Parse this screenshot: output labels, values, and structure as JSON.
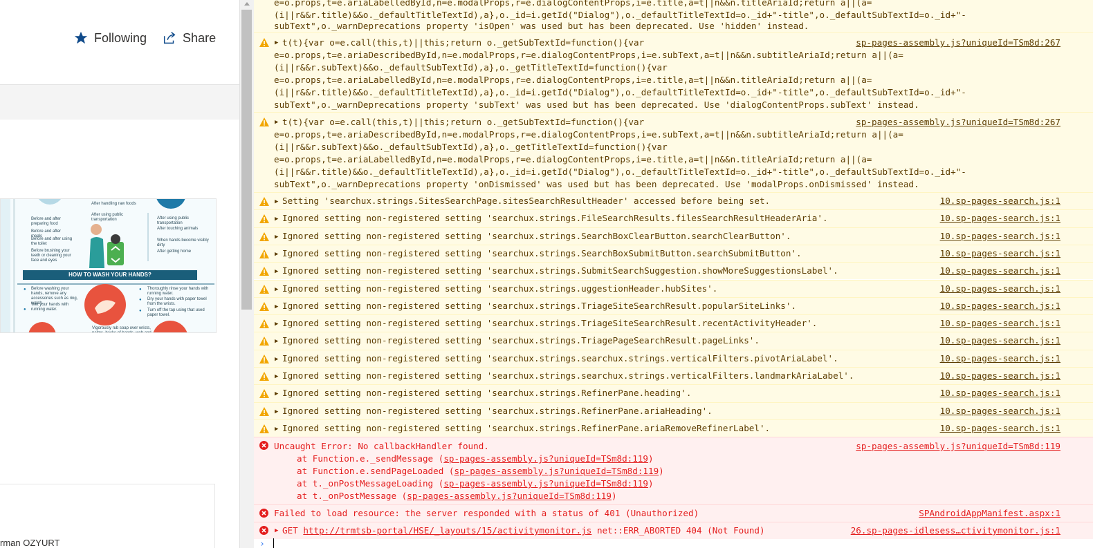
{
  "page": {
    "following_label": "Following",
    "share_label": "Share",
    "author_partial": "rman OZYURT"
  },
  "poster": {
    "col1": [
      "Before and after preparing food",
      "Before and after meals",
      "Before and after using the toilet",
      "Before brushing your teeth or cleaning your face and eyes"
    ],
    "col2_top": "After handling raw foods",
    "col2_b": "After using public transportation",
    "col3": [
      "After using public transportation",
      "After touching animals",
      "When hands become visibly dirty",
      "After getting home"
    ],
    "header": "HOW TO WASH YOUR HANDS?",
    "steps_left": [
      "Before washing your hands, remove any accessories such as ring, watch.",
      "Wet your hands with running water."
    ],
    "steps_right": [
      "Thoroughly rinse your hands with running water.",
      "Dry your hands with paper towel from the wrists.",
      "Turn off the tap using that used paper towel."
    ],
    "step_bottom": "Vigorously rub soap over wrists, palms, backs of hands, web and"
  },
  "console": {
    "warn_top_lines": [
      "e=o.props,t=e.ariaLabelledById,n=e.modalProps,r=e.dialogContentProps,i=e.title,a=t||n&&n.titleAriaId;return a||(a=",
      "(i||r&&r.title)&&o._defaultTitleTextId),a},o._id=i.getId(\"Dialog\"),o._defaultTitleTextId=o._id+\"-title\",o._defaultSubTextId=o._id+\"-",
      "subText\",o._warnDeprecations property 'isOpen' was used but has been deprecated. Use 'hidden' instead."
    ],
    "warn_block2_lines": [
      "t(t){var o=e.call(this,t)||this;return o._getSubTextId=function(){var",
      "e=o.props,t=e.ariaDescribedById,n=e.modalProps,r=e.dialogContentProps,i=e.subText,a=t||n&&n.subtitleAriaId;return a||(a=",
      "(i||r&&r.subText)&&o._defaultSubTextId),a},o._getTitleTextId=function(){var",
      "e=o.props,t=e.ariaLabelledById,n=e.modalProps,r=e.dialogContentProps,i=e.title,a=t||n&&n.titleAriaId;return a||(a=",
      "(i||r&&r.title)&&o._defaultTitleTextId),a},o._id=i.getId(\"Dialog\"),o._defaultTitleTextId=o._id+\"-title\",o._defaultSubTextId=o._id+\"-",
      "subText\",o._warnDeprecations property 'subText' was used but has been deprecated. Use 'dialogContentProps.subText' instead."
    ],
    "warn_block2_src": "sp-pages-assembly.js?uniqueId=TSm8d:267",
    "warn_block3_lines": [
      "t(t){var o=e.call(this,t)||this;return o._getSubTextId=function(){var",
      "e=o.props,t=e.ariaDescribedById,n=e.modalProps,r=e.dialogContentProps,i=e.subText,a=t||n&&n.subtitleAriaId;return a||(a=",
      "(i||r&&r.subText)&&o._defaultSubTextId),a},o._getTitleTextId=function(){var",
      "e=o.props,t=e.ariaLabelledById,n=e.modalProps,r=e.dialogContentProps,i=e.title,a=t||n&&n.titleAriaId;return a||(a=",
      "(i||r&&r.title)&&o._defaultTitleTextId),a},o._id=i.getId(\"Dialog\"),o._defaultTitleTextId=o._id+\"-title\",o._defaultSubTextId=o._id+\"-",
      "subText\",o._warnDeprecations property 'onDismissed' was used but has been deprecated. Use 'modalProps.onDismissed' instead."
    ],
    "warn_block3_src": "sp-pages-assembly.js?uniqueId=TSm8d:267",
    "search_warnings": [
      {
        "msg": "Setting 'searchux.strings.SitesSearchPage.sitesSearchResultHeader' accessed before being set.",
        "src": "10.sp-pages-search.js:1"
      },
      {
        "msg": "Ignored setting non-registered setting 'searchux.strings.FileSearchResults.filesSearchResultHeaderAria'.",
        "src": "10.sp-pages-search.js:1"
      },
      {
        "msg": "Ignored setting non-registered setting 'searchux.strings.SearchBoxClearButton.searchClearButton'.",
        "src": "10.sp-pages-search.js:1"
      },
      {
        "msg": "Ignored setting non-registered setting 'searchux.strings.SearchBoxSubmitButton.searchSubmitButton'.",
        "src": "10.sp-pages-search.js:1"
      },
      {
        "msg": "Ignored setting non-registered setting 'searchux.strings.SubmitSearchSuggestion.showMoreSuggestionsLabel'.",
        "src": "10.sp-pages-search.js:1"
      },
      {
        "msg": "Ignored setting non-registered setting 'searchux.strings.uggestionHeader.hubSites'.",
        "src": "10.sp-pages-search.js:1"
      },
      {
        "msg": "Ignored setting non-registered setting 'searchux.strings.TriageSiteSearchResult.popularSiteLinks'.",
        "src": "10.sp-pages-search.js:1"
      },
      {
        "msg": "Ignored setting non-registered setting 'searchux.strings.TriageSiteSearchResult.recentActivityHeader'.",
        "src": "10.sp-pages-search.js:1"
      },
      {
        "msg": "Ignored setting non-registered setting 'searchux.strings.TriagePageSearchResult.pageLinks'.",
        "src": "10.sp-pages-search.js:1"
      },
      {
        "msg": "Ignored setting non-registered setting 'searchux.strings.searchux.strings.verticalFilters.pivotAriaLabel'.",
        "src": "10.sp-pages-search.js:1"
      },
      {
        "msg": "Ignored setting non-registered setting 'searchux.strings.searchux.strings.verticalFilters.landmarkAriaLabel'.",
        "src": "10.sp-pages-search.js:1"
      },
      {
        "msg": "Ignored setting non-registered setting 'searchux.strings.RefinerPane.heading'.",
        "src": "10.sp-pages-search.js:1"
      },
      {
        "msg": "Ignored setting non-registered setting 'searchux.strings.RefinerPane.ariaHeading'.",
        "src": "10.sp-pages-search.js:1"
      },
      {
        "msg": "Ignored setting non-registered setting 'searchux.strings.RefinerPane.ariaRemoveRefinerLabel'.",
        "src": "10.sp-pages-search.js:1"
      }
    ],
    "error1": {
      "msg": "Uncaught Error: No callbackHandler found.",
      "src": "sp-pages-assembly.js?uniqueId=TSm8d:119",
      "stack": [
        {
          "pre": "at Function.e._sendMessage (",
          "link": "sp-pages-assembly.js?uniqueId=TSm8d:119",
          "post": ")"
        },
        {
          "pre": "at Function.e.sendPageLoaded (",
          "link": "sp-pages-assembly.js?uniqueId=TSm8d:119",
          "post": ")"
        },
        {
          "pre": "at t._onPostMessageLoading (",
          "link": "sp-pages-assembly.js?uniqueId=TSm8d:119",
          "post": ")"
        },
        {
          "pre": "at t._onPostMessage (",
          "link": "sp-pages-assembly.js?uniqueId=TSm8d:119",
          "post": ")"
        }
      ]
    },
    "error2": {
      "msg": "Failed to load resource: the server responded with a status of 401 (Unauthorized)",
      "src": "SPAndroidAppManifest.aspx:1"
    },
    "error3": {
      "pre": "GET ",
      "url": "http://trmtsb-portal/HSE/_layouts/15/activitymonitor.js",
      "post": " net::ERR_ABORTED 404 (Not Found)",
      "src": "26.sp-pages-idlesess…ctivitymonitor.js:1"
    },
    "prompt_symbol": "›",
    "colors": {
      "warn_bg": "#fffbe5",
      "err_bg": "#fff0f0",
      "err_text": "#e41e1e",
      "warn_text": "#5c3c00",
      "accent": "#0f4a8a"
    }
  }
}
